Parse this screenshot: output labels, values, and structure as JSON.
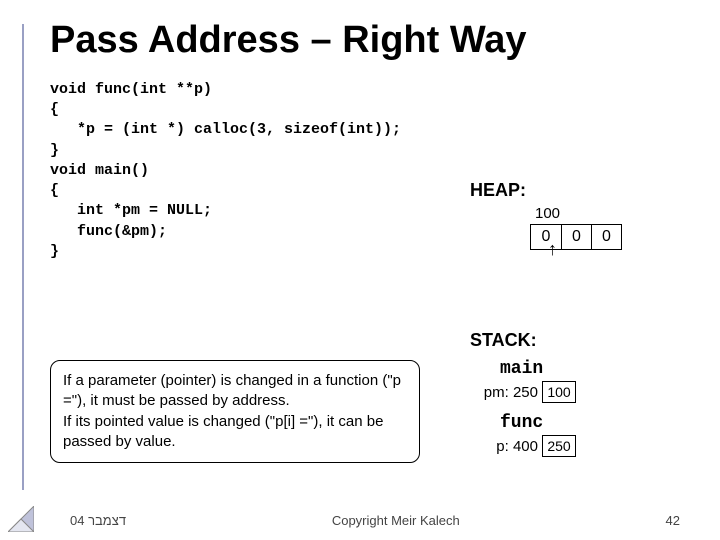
{
  "title": "Pass Address –\nRight Way",
  "code": "void func(int **p)\n{\n   *p = (int *) calloc(3, sizeof(int));\n}\nvoid main()\n{\n   int *pm = NULL;\n   func(&pm);\n}",
  "callout": "If a parameter (pointer) is changed in a function (\"p =\"), it must be passed by address.\nIf its pointed value is changed (\"p[i] =\"), it can be passed by value.",
  "heap": {
    "title": "HEAP:",
    "address": "100",
    "cells": [
      "0",
      "0",
      "0"
    ]
  },
  "stack": {
    "title": "STACK:",
    "frames": [
      {
        "name": "main",
        "var_label": "pm: 250",
        "value": "100"
      },
      {
        "name": "func",
        "var_label": "p: 400",
        "value": "250"
      }
    ]
  },
  "footer": {
    "left": "דצמבר 04",
    "center": "Copyright Meir Kalech",
    "right": "42"
  }
}
